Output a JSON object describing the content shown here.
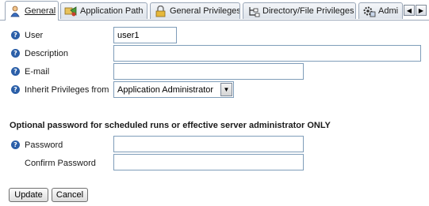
{
  "tabs": [
    {
      "label": "General",
      "icon": "user-icon",
      "active": true
    },
    {
      "label": "Application Path",
      "icon": "application-path-icon",
      "active": false
    },
    {
      "label": "General Privileges",
      "icon": "lock-icon",
      "active": false
    },
    {
      "label": "Directory/File Privileges",
      "icon": "directory-icon",
      "active": false
    },
    {
      "label": "Admi",
      "icon": "admin-icon",
      "active": false
    }
  ],
  "tab_nav": {
    "prev": "◀",
    "next": "▶"
  },
  "form": {
    "help_glyph": "?",
    "user": {
      "label": "User",
      "value": "user1"
    },
    "description": {
      "label": "Description",
      "value": ""
    },
    "email": {
      "label": "E-mail",
      "value": ""
    },
    "inherit": {
      "label": "Inherit Privileges from",
      "value": "Application Administrator",
      "arrow": "▼"
    }
  },
  "password_section": {
    "heading": "Optional password for scheduled runs or effective server administrator ONLY",
    "password": {
      "label": "Password",
      "value": ""
    },
    "confirm": {
      "label": "Confirm Password",
      "value": ""
    }
  },
  "buttons": {
    "update": "Update",
    "cancel": "Cancel"
  },
  "colors": {
    "help_icon": "#2b5fa8",
    "input_border": "#7f9db9",
    "tab_border": "#9aa7b8"
  }
}
